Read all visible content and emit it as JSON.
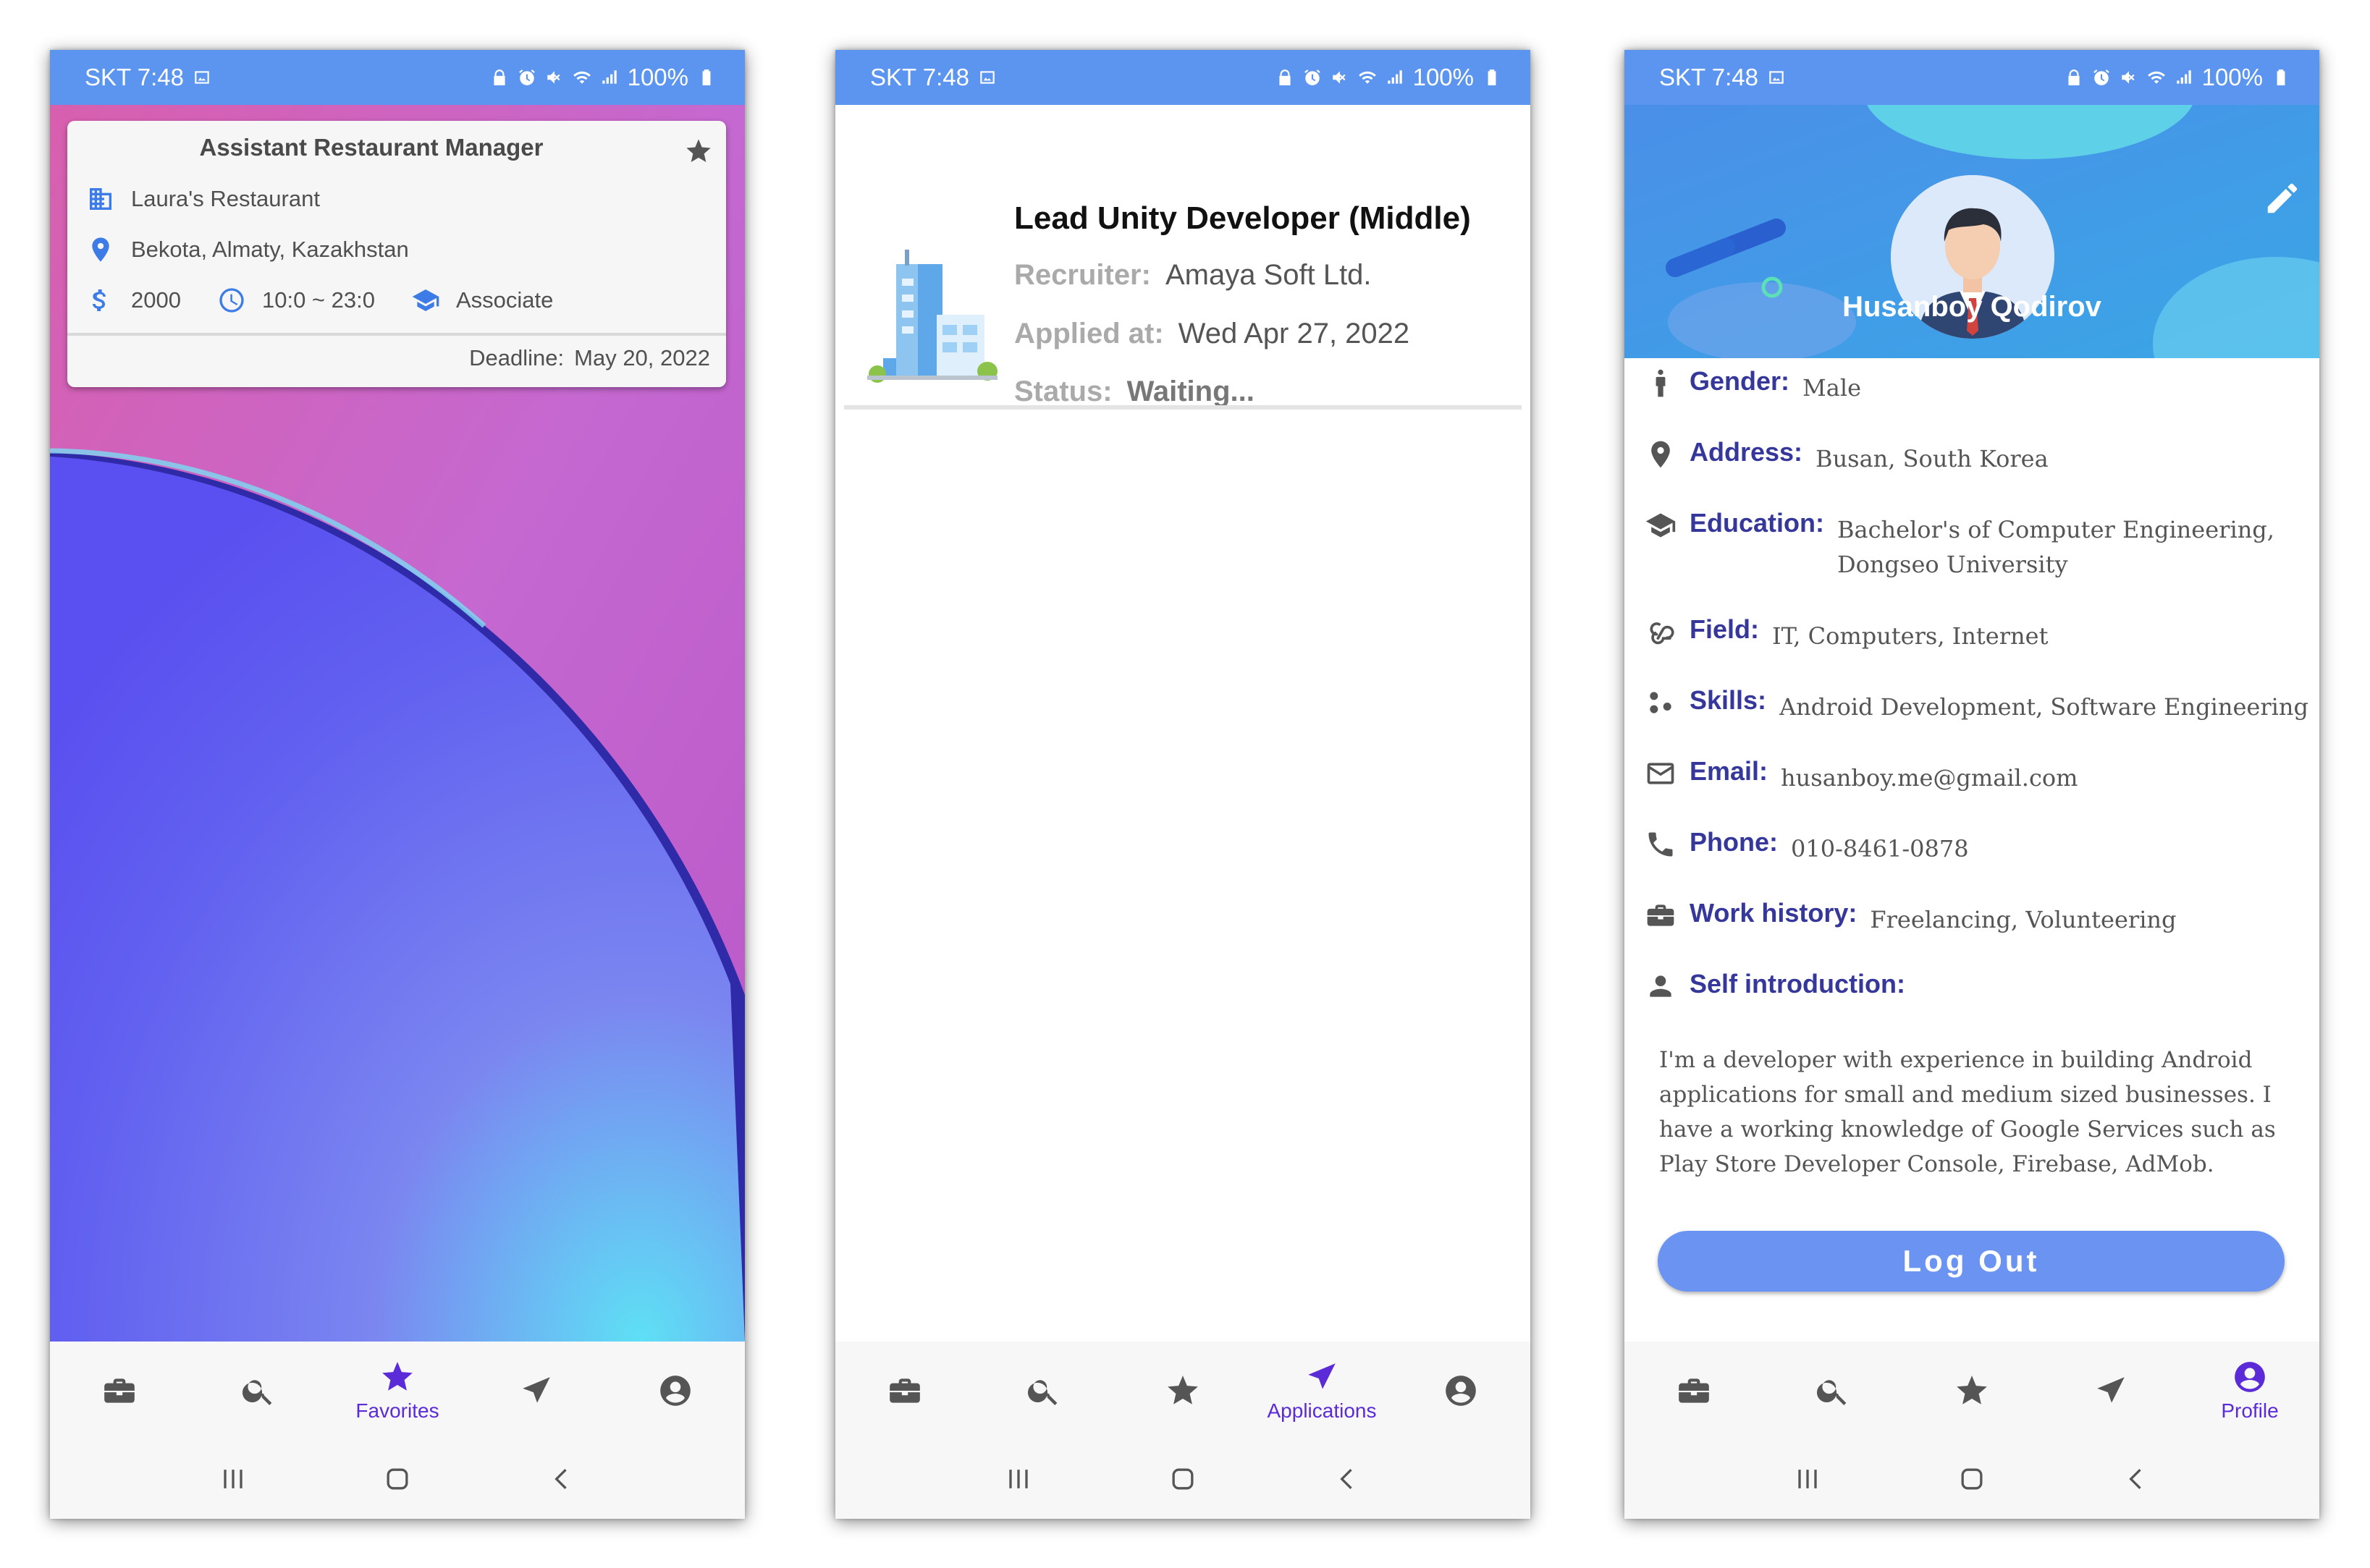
{
  "status_bar": {
    "carrier_time": "SKT 7:48",
    "battery": "100%"
  },
  "nav": {
    "jobs_label": "Jobs",
    "search_label": "Search",
    "favorites_label": "Favorites",
    "applications_label": "Applications",
    "profile_label": "Profile"
  },
  "favorites_screen": {
    "job": {
      "title": "Assistant Restaurant Manager",
      "company": "Laura's Restaurant",
      "location": "Bekota, Almaty, Kazakhstan",
      "salary": "2000",
      "hours": "10:0 ~ 23:0",
      "education": "Associate",
      "deadline_label": "Deadline:",
      "deadline_value": "May 20, 2022"
    }
  },
  "applications_screen": {
    "application": {
      "title": "Lead Unity Developer (Middle)",
      "recruiter_label": "Recruiter:",
      "recruiter_value": "Amaya Soft Ltd.",
      "applied_label": "Applied at:",
      "applied_value": "Wed Apr 27, 2022",
      "status_label": "Status:",
      "status_value": "Waiting..."
    }
  },
  "profile_screen": {
    "name": "Husanboy Qodirov",
    "gender_label": "Gender:",
    "gender_value": "Male",
    "address_label": "Address:",
    "address_value": "Busan, South Korea",
    "education_label": "Education:",
    "education_value_line1": "Bachelor's of Computer Engineering,",
    "education_value_line2": "Dongseo University",
    "field_label": "Field:",
    "field_value": "IT, Computers, Internet",
    "skills_label": "Skills:",
    "skills_value": "Android Development, Software Engineering",
    "email_label": "Email:",
    "email_value": "husanboy.me@gmail.com",
    "phone_label": "Phone:",
    "phone_value": "010-8461-0878",
    "work_label": "Work history:",
    "work_value": "Freelancing, Volunteering",
    "intro_label": "Self introduction:",
    "intro_text": "I'm a developer with experience in building Android applications for small and medium sized businesses. I have a working knowledge of Google Services such as Play Store Developer Console, Firebase, AdMob.",
    "logout_label": "Log Out"
  },
  "colors": {
    "status_bar": "#5b95ef",
    "accent_purple": "#5b2bd8",
    "label_navy": "#35379a",
    "icon_blue": "#3d7be6",
    "logout_button": "#6b93f2"
  },
  "icons": {
    "nav": [
      "briefcase-icon",
      "search-icon",
      "star-icon",
      "send-icon",
      "account-circle-icon"
    ],
    "favorites_card": [
      "building-icon",
      "location-pin-icon",
      "dollar-icon",
      "clock-icon",
      "graduation-cap-icon",
      "star-icon"
    ],
    "profile_rows": [
      "person-icon",
      "location-pin-icon",
      "graduation-cap-icon",
      "webhook-icon",
      "scatter-icon",
      "mail-icon",
      "phone-icon",
      "briefcase-icon",
      "person-icon",
      "edit-pencil-icon"
    ]
  }
}
